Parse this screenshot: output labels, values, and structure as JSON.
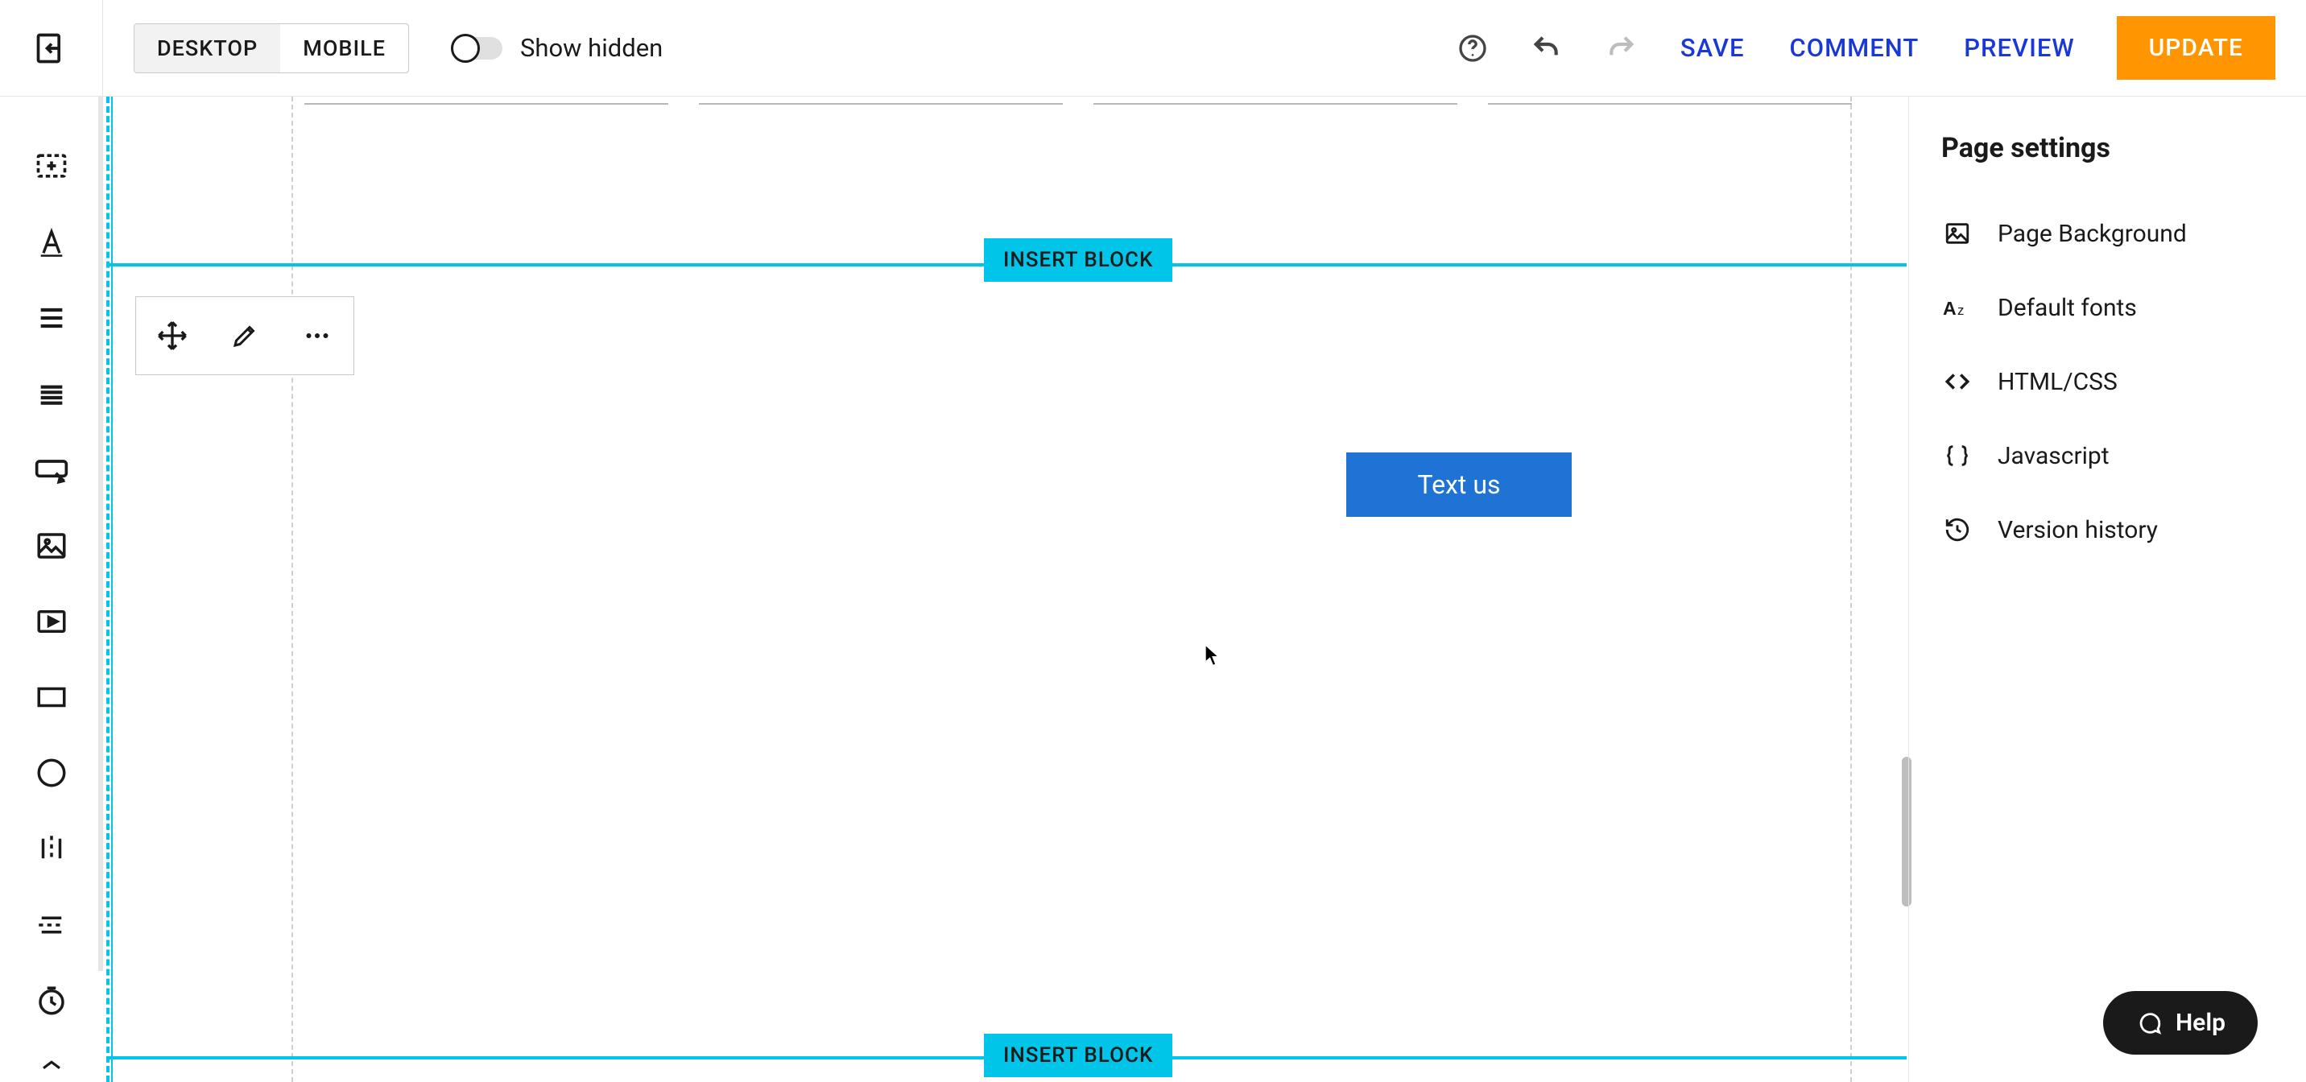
{
  "topbar": {
    "device_desktop": "DESKTOP",
    "device_mobile": "MOBILE",
    "show_hidden_label": "Show hidden",
    "save": "SAVE",
    "comment": "COMMENT",
    "preview": "PREVIEW",
    "update": "UPDATE"
  },
  "canvas": {
    "insert_block_top": "INSERT BLOCK",
    "insert_block_bot": "INSERT BLOCK",
    "button_text": "Text us"
  },
  "rightpanel": {
    "title": "Page settings",
    "items": [
      "Page Background",
      "Default fonts",
      "HTML/CSS",
      "Javascript",
      "Version history"
    ]
  },
  "help": {
    "label": "Help"
  }
}
